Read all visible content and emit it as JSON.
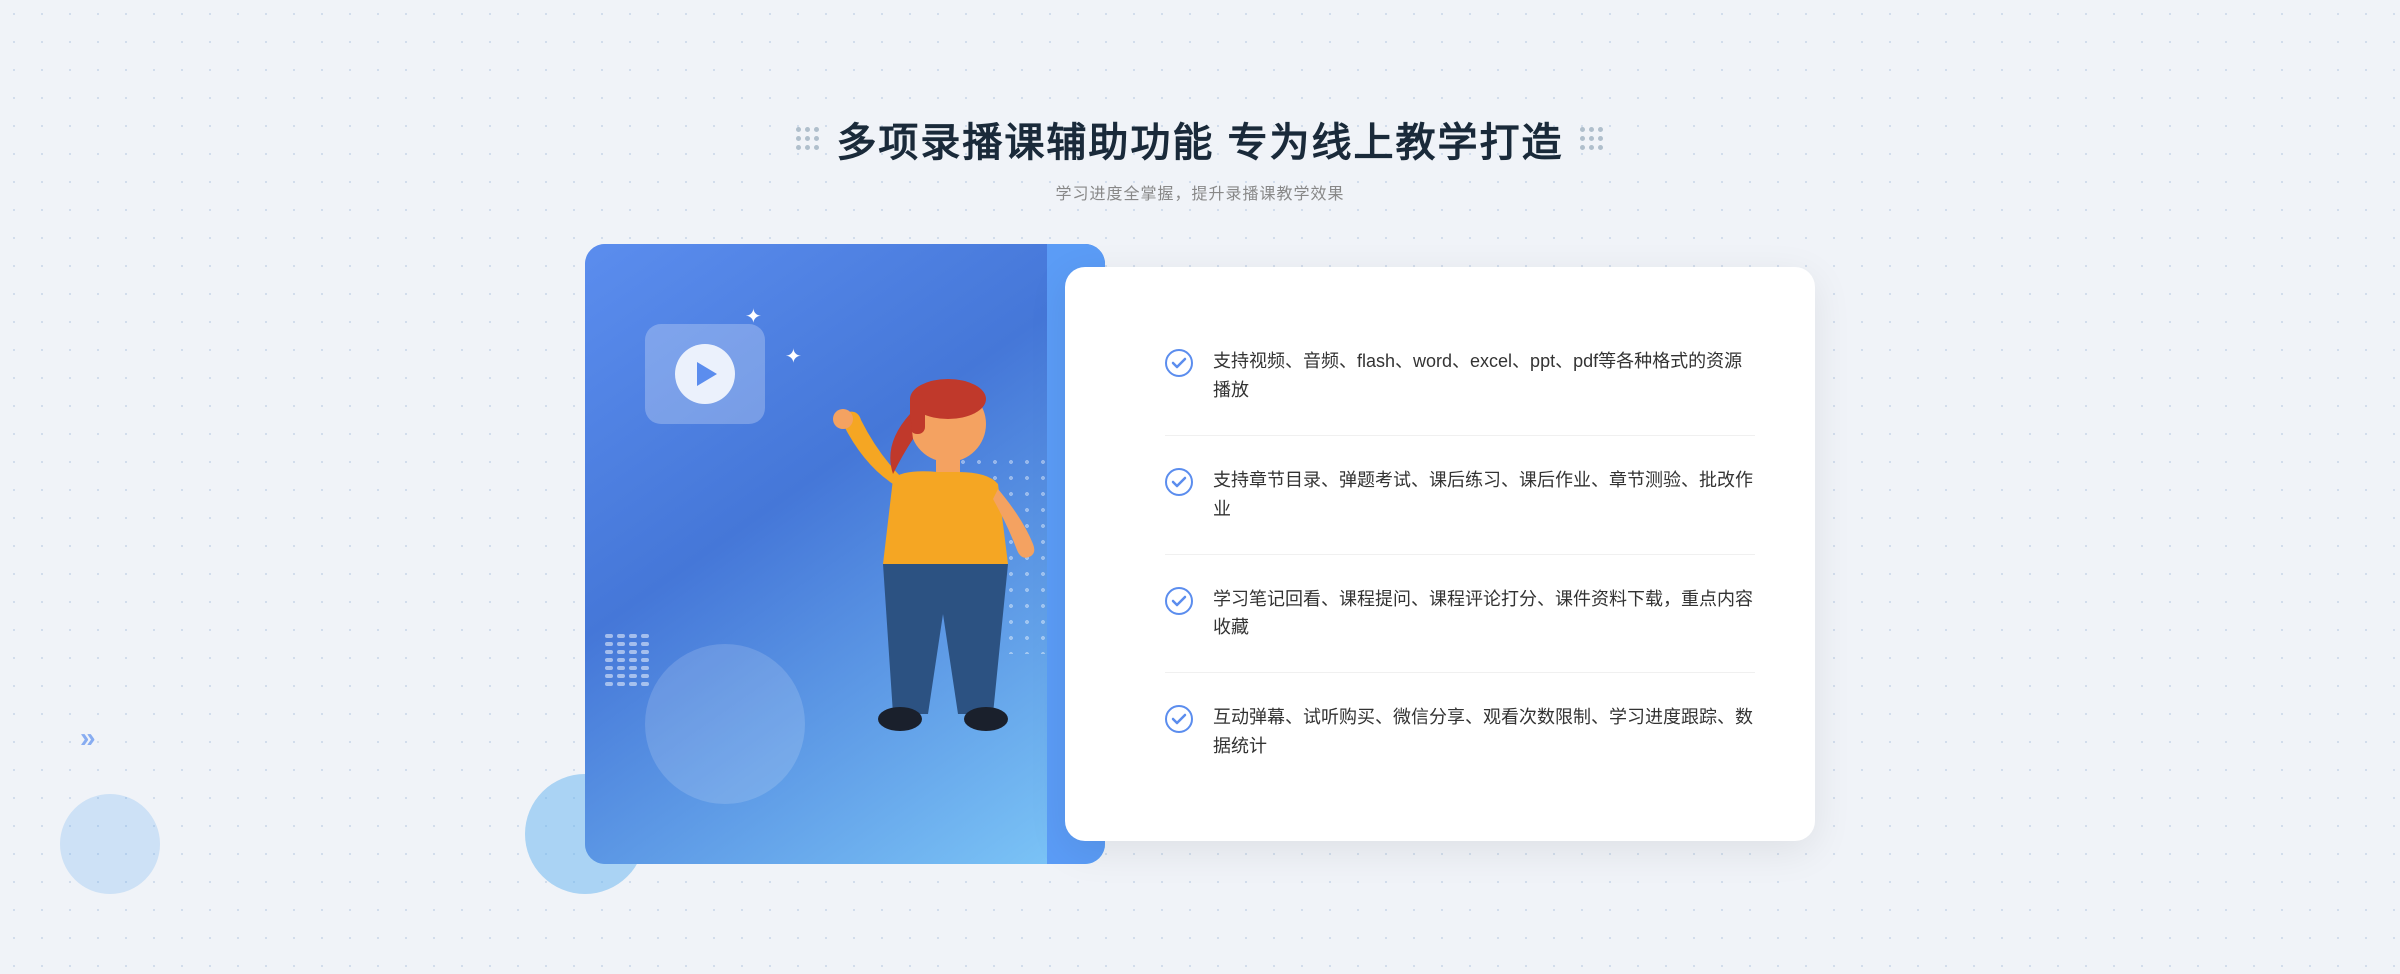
{
  "header": {
    "title": "多项录播课辅助功能 专为线上教学打造",
    "subtitle": "学习进度全掌握，提升录播课教学效果",
    "deco_left": "decorative",
    "deco_right": "decorative"
  },
  "features": [
    {
      "id": 1,
      "text": "支持视频、音频、flash、word、excel、ppt、pdf等各种格式的资源播放"
    },
    {
      "id": 2,
      "text": "支持章节目录、弹题考试、课后练习、课后作业、章节测验、批改作业"
    },
    {
      "id": 3,
      "text": "学习笔记回看、课程提问、课程评论打分、课件资料下载，重点内容收藏"
    },
    {
      "id": 4,
      "text": "互动弹幕、试听购买、微信分享、观看次数限制、学习进度跟踪、数据统计"
    }
  ],
  "colors": {
    "primary": "#5b8dee",
    "title": "#1a2a3a",
    "text": "#333333",
    "subtitle": "#888888",
    "check": "#5b8dee",
    "divider": "#f0f0f0"
  },
  "arrows": {
    "left_chevron": "»",
    "left_arrow": "»"
  }
}
